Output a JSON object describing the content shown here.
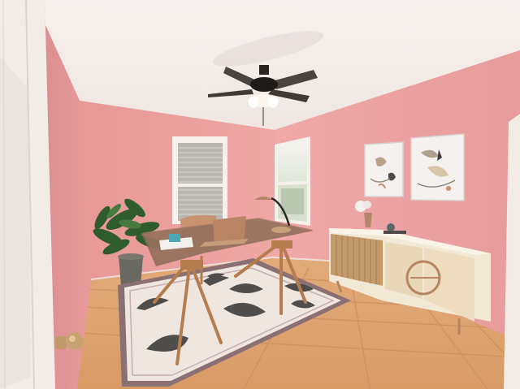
{
  "scene": {
    "kind": "photo",
    "room": "home office",
    "palette": {
      "wall": "#eda3a3",
      "wall_shadow": "#d88d8f",
      "ceiling": "#f3ecea",
      "floor": "#dea36f",
      "floor_grout": "#c88d5f",
      "door": "#f3eeea",
      "rug_fill": "#efe7df",
      "rug_border": "#8a6f73",
      "rug_pattern": "#4f4e4d",
      "desk_wood": "#bc7d4c",
      "sideboard": "#f2e8d6",
      "sideboard_slats": "#c59a69",
      "plant": "#2f5b2e"
    },
    "objects": [
      "ceiling-fan",
      "window-left",
      "window-right",
      "wall-art-left",
      "wall-art-right",
      "desk",
      "desk-lamp",
      "laptop",
      "chair",
      "plant",
      "rug",
      "sideboard",
      "door"
    ]
  }
}
